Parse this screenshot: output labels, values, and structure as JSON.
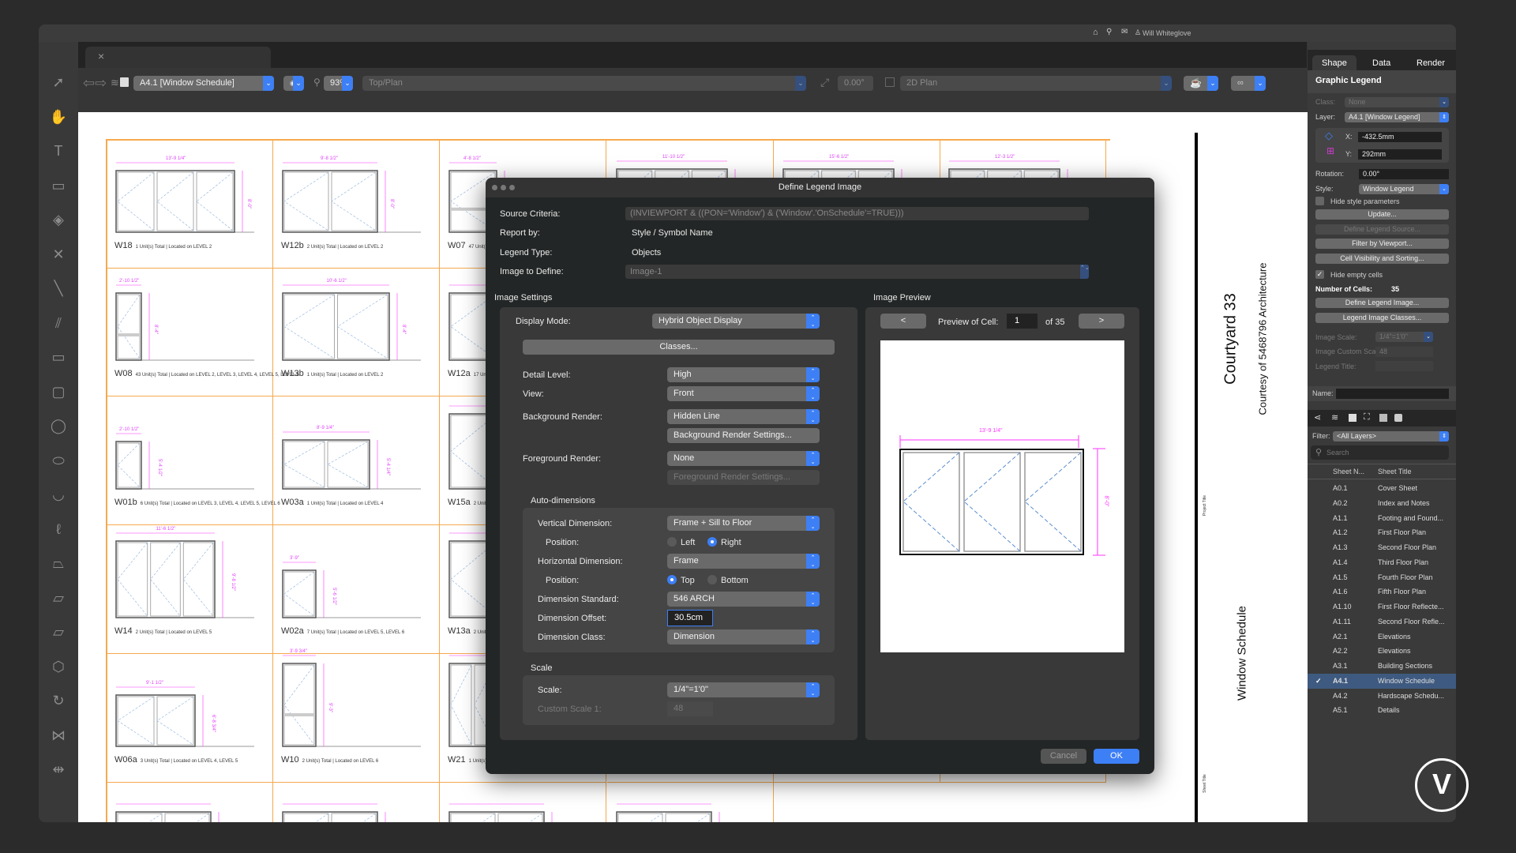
{
  "topbar": {
    "user": "Will Whiteglove",
    "icons": [
      "home-icon",
      "search-icon",
      "mail-icon",
      "user-icon"
    ]
  },
  "toolbar": {
    "sheet_select": "A4.1 [Window Schedule]",
    "zoom": "93%",
    "view": "Top/Plan",
    "rotation": "0.00°",
    "render_mode": "2D Plan"
  },
  "tools": [
    "selection",
    "pan",
    "text",
    "callout",
    "layer-link",
    "x-mark",
    "line",
    "double-line",
    "rectangle",
    "rounded-rectangle",
    "circle",
    "oval",
    "arc",
    "freehand",
    "polyline",
    "polygon",
    "polygon-2",
    "hexagon",
    "rotate",
    "mirror",
    "dimension"
  ],
  "sheet": {
    "cells": [
      {
        "id": "W18",
        "info": "1 Unit(s) Total | Located on LEVEL 2",
        "width_dim": "13'-9 1/4\"",
        "height_dim": "8'-0\""
      },
      {
        "id": "W12b",
        "info": "2 Unit(s) Total | Located on LEVEL 2",
        "width_dim": "9'-8 1/2\"",
        "height_dim": "8'-0\""
      },
      {
        "id": "W07",
        "info": "47 Unit(s)",
        "width_dim": "4'-8 1/2\"",
        "height_dim": ""
      },
      {
        "id": "W08",
        "info": "43 Unit(s) Total | Located on LEVEL 2, LEVEL 3, LEVEL 4, LEVEL 5, LEVEL 6",
        "width_dim": "2'-10 1/2\"",
        "height_dim": "8'-4\""
      },
      {
        "id": "W13b",
        "info": "1 Unit(s) Total | Located on LEVEL 2",
        "width_dim": "10'-6 1/2\"",
        "height_dim": "8'-4\""
      },
      {
        "id": "W12a",
        "info": "17 Unit(s)",
        "width_dim": "",
        "height_dim": ""
      },
      {
        "id": "W01b",
        "info": "6 Unit(s) Total | Located on LEVEL 3, LEVEL 4, LEVEL 5, LEVEL 6",
        "width_dim": "2'-10 1/2\"",
        "height_dim": "5'-4 1/2\""
      },
      {
        "id": "W03a",
        "info": "1 Unit(s) Total | Located on LEVEL 4",
        "width_dim": "8'-9 1/4\"",
        "height_dim": "5'-4 1/4\""
      },
      {
        "id": "W15a",
        "info": "2 Unit(s)",
        "width_dim": "",
        "height_dim": ""
      },
      {
        "id": "W14",
        "info": "2 Unit(s) Total | Located on LEVEL 5",
        "width_dim": "11'-6 1/2\"",
        "height_dim": "9'-8 1/2\""
      },
      {
        "id": "W02a",
        "info": "7 Unit(s) Total | Located on LEVEL 5, LEVEL 6",
        "width_dim": "3'-9\"",
        "height_dim": "5'-6 1/2\""
      },
      {
        "id": "W13a",
        "info": "2 Unit(s)",
        "width_dim": "",
        "height_dim": ""
      },
      {
        "id": "W06a",
        "info": "3 Unit(s) Total | Located on LEVEL 4, LEVEL 5",
        "width_dim": "9'-1 1/2\"",
        "height_dim": "6'-8 3/4\""
      },
      {
        "id": "W10",
        "info": "2 Unit(s) Total | Located on LEVEL 6",
        "width_dim": "3'-9 3/4\"",
        "height_dim": "9'-3\""
      },
      {
        "id": "W21",
        "info": "1 Unit(s)",
        "width_dim": "",
        "height_dim": ""
      }
    ],
    "top_row_dims": [
      "11'-10 1/2\"",
      "15'-6 1/2\"",
      "12'-3 1/2\""
    ],
    "title_block": {
      "project_label": "Project Title",
      "project": "Courtyard 33",
      "courtesy": "Courtesy of 5468796 Architecture",
      "sheet_label": "Sheet Title",
      "sheet_title": "Window Schedule"
    }
  },
  "dialog": {
    "title": "Define Legend Image",
    "source_criteria_label": "Source Criteria:",
    "source_criteria": "(INVIEWPORT & ((PON='Window') & ('Window'.'OnSchedule'=TRUE)))",
    "report_by_label": "Report by:",
    "report_by": "Style / Symbol Name",
    "legend_type_label": "Legend Type:",
    "legend_type": "Objects",
    "image_to_define_label": "Image to Define:",
    "image_to_define": "Image-1",
    "image_settings": {
      "title": "Image Settings",
      "display_mode_label": "Display Mode:",
      "display_mode": "Hybrid Object Display",
      "classes_button": "Classes...",
      "detail_level_label": "Detail Level:",
      "detail_level": "High",
      "view_label": "View:",
      "view": "Front",
      "bg_render_label": "Background Render:",
      "bg_render": "Hidden Line",
      "bg_settings_button": "Background Render Settings...",
      "fg_render_label": "Foreground Render:",
      "fg_render": "None",
      "fg_settings_button": "Foreground Render Settings..."
    },
    "auto_dimensions": {
      "title": "Auto-dimensions",
      "vertical_label": "Vertical Dimension:",
      "vertical": "Frame + Sill to Floor",
      "position_label": "Position:",
      "v_left": "Left",
      "v_right": "Right",
      "v_selected": "Right",
      "horizontal_label": "Horizontal Dimension:",
      "horizontal": "Frame",
      "h_top": "Top",
      "h_bottom": "Bottom",
      "h_selected": "Top",
      "standard_label": "Dimension Standard:",
      "standard": "546 ARCH",
      "offset_label": "Dimension Offset:",
      "offset": "30.5cm",
      "class_label": "Dimension Class:",
      "class": "Dimension"
    },
    "scale": {
      "title": "Scale",
      "scale_label": "Scale:",
      "scale": "1/4\"=1'0\"",
      "custom_label": "Custom Scale 1:",
      "custom": "48"
    },
    "preview": {
      "title": "Image Preview",
      "prev": "<",
      "next": ">",
      "cell_label": "Preview of Cell:",
      "cell": "1",
      "of": "of 35",
      "width_dim": "13'-9 1/4\"",
      "height_dim": "8'-0\""
    },
    "cancel": "Cancel",
    "ok": "OK"
  },
  "panel": {
    "tabs": [
      "Shape",
      "Data",
      "Render"
    ],
    "active_tab": "Shape",
    "header": "Graphic Legend",
    "class_label": "Class:",
    "class": "None",
    "layer_label": "Layer:",
    "layer": "A4.1 [Window Legend]",
    "x_label": "X:",
    "x": "-432.5mm",
    "y_label": "Y:",
    "y": "292mm",
    "rotation_label": "Rotation:",
    "rotation": "0.00°",
    "style_label": "Style:",
    "style": "Window Legend",
    "hide_style": "Hide style parameters",
    "hide_style_checked": false,
    "update": "Update...",
    "define_source": "Define Legend Source...",
    "filter_viewport": "Filter by Viewport...",
    "cell_visibility": "Cell Visibility and Sorting...",
    "hide_empty": "Hide empty cells",
    "hide_empty_checked": true,
    "cells_label": "Number of Cells:",
    "cells": "35",
    "define_image": "Define Legend Image...",
    "image_classes": "Legend Image Classes...",
    "image_scale_label": "Image Scale:",
    "image_scale": "1/4\"=1'0\"",
    "custom_scale_label": "Image Custom Scale 1:",
    "custom_scale": "48",
    "legend_title_label": "Legend Title:",
    "name_label": "Name:"
  },
  "navigator": {
    "filter_label": "Filter:",
    "filter": "<All Layers>",
    "search_placeholder": "Search",
    "col_number": "Sheet N...",
    "col_title": "Sheet Title",
    "rows": [
      {
        "n": "A0.1",
        "t": "Cover Sheet"
      },
      {
        "n": "A0.2",
        "t": "Index and Notes"
      },
      {
        "n": "A1.1",
        "t": "Footing and Found..."
      },
      {
        "n": "A1.2",
        "t": "First Floor Plan"
      },
      {
        "n": "A1.3",
        "t": "Second Floor Plan"
      },
      {
        "n": "A1.4",
        "t": "Third Floor Plan"
      },
      {
        "n": "A1.5",
        "t": "Fourth Floor Plan"
      },
      {
        "n": "A1.6",
        "t": "Fifth Floor Plan"
      },
      {
        "n": "A1.10",
        "t": "First Floor Reflecte..."
      },
      {
        "n": "A1.11",
        "t": "Second Floor Refle..."
      },
      {
        "n": "A2.1",
        "t": "Elevations"
      },
      {
        "n": "A2.2",
        "t": "Elevations"
      },
      {
        "n": "A3.1",
        "t": "Building Sections"
      },
      {
        "n": "A4.1",
        "t": "Window Schedule",
        "selected": true
      },
      {
        "n": "A4.2",
        "t": "Hardscape Schedu..."
      },
      {
        "n": "A5.1",
        "t": "Details"
      }
    ]
  },
  "colors": {
    "accent": "#3d7ff5",
    "grid": "#f6a94e",
    "dimension": "#e040fb",
    "selected_row": "#3f5a80"
  }
}
